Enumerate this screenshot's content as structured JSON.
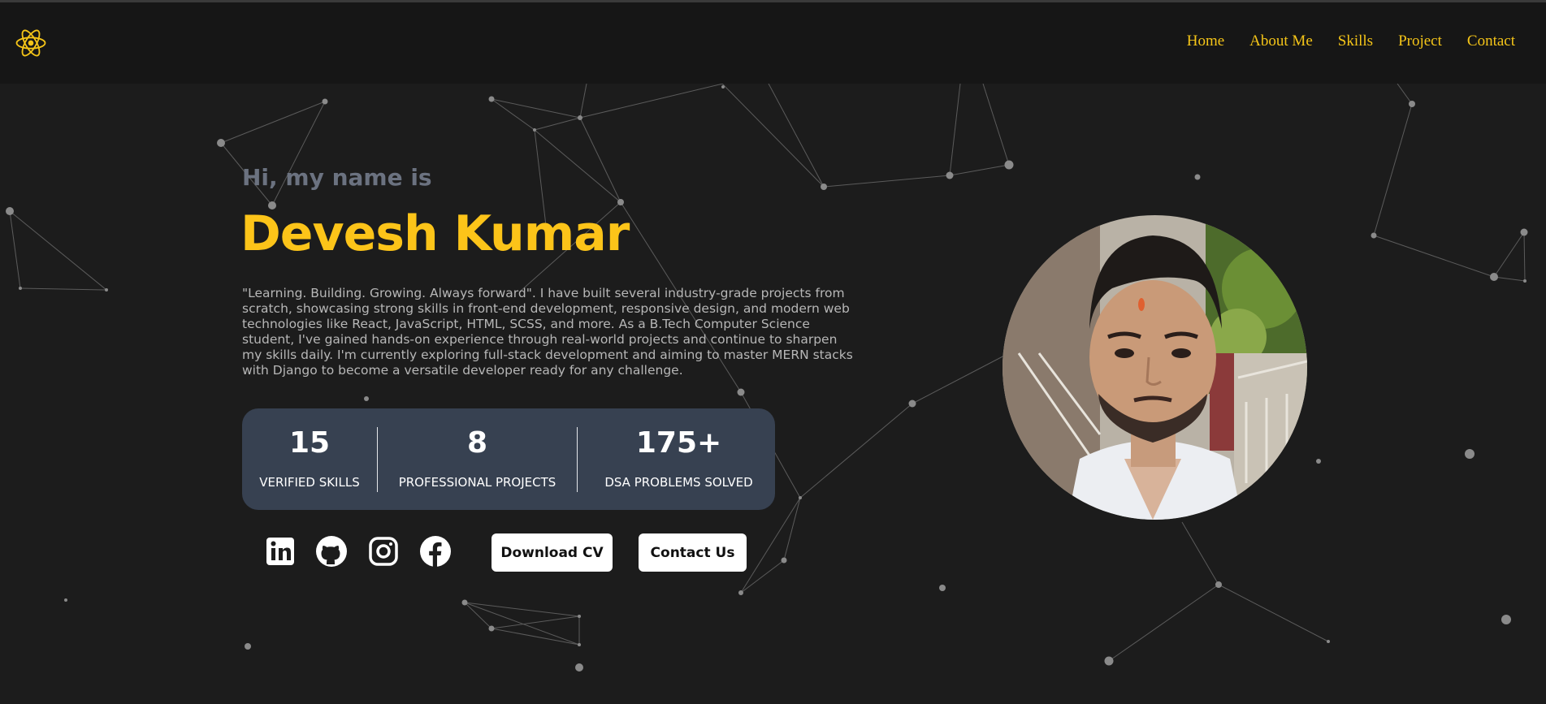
{
  "nav": {
    "items": [
      "Home",
      "About Me",
      "Skills",
      "Project",
      "Contact"
    ]
  },
  "hero": {
    "greeting": "Hi, my name is",
    "name": "Devesh Kumar",
    "bio": "\"Learning. Building. Growing. Always forward\". I have built several industry-grade projects from scratch, showcasing strong skills in front-end development, responsive design, and modern web technologies like React, JavaScript, HTML, SCSS, and more. As a B.Tech Computer Science student, I've gained hands-on experience through real-world projects and continue to sharpen my skills daily. I'm currently exploring full-stack development and aiming to master MERN stacks with Django to become a versatile developer ready for any challenge."
  },
  "stats": [
    {
      "value": "15",
      "label": "VERIFIED SKILLS"
    },
    {
      "value": "8",
      "label": "PROFESSIONAL PROJECTS"
    },
    {
      "value": "175+",
      "label": "DSA PROBLEMS SOLVED"
    }
  ],
  "buttons": {
    "download_cv": "Download CV",
    "contact_us": "Contact Us"
  },
  "social_icons": [
    "linkedin-icon",
    "github-icon",
    "instagram-icon",
    "facebook-icon"
  ],
  "colors": {
    "accent": "#fcc419",
    "nav_text": "#f5c518",
    "background": "#1c1c1c",
    "header_bg": "#161616",
    "stats_bg": "#374151",
    "greeting": "#6b7280"
  }
}
